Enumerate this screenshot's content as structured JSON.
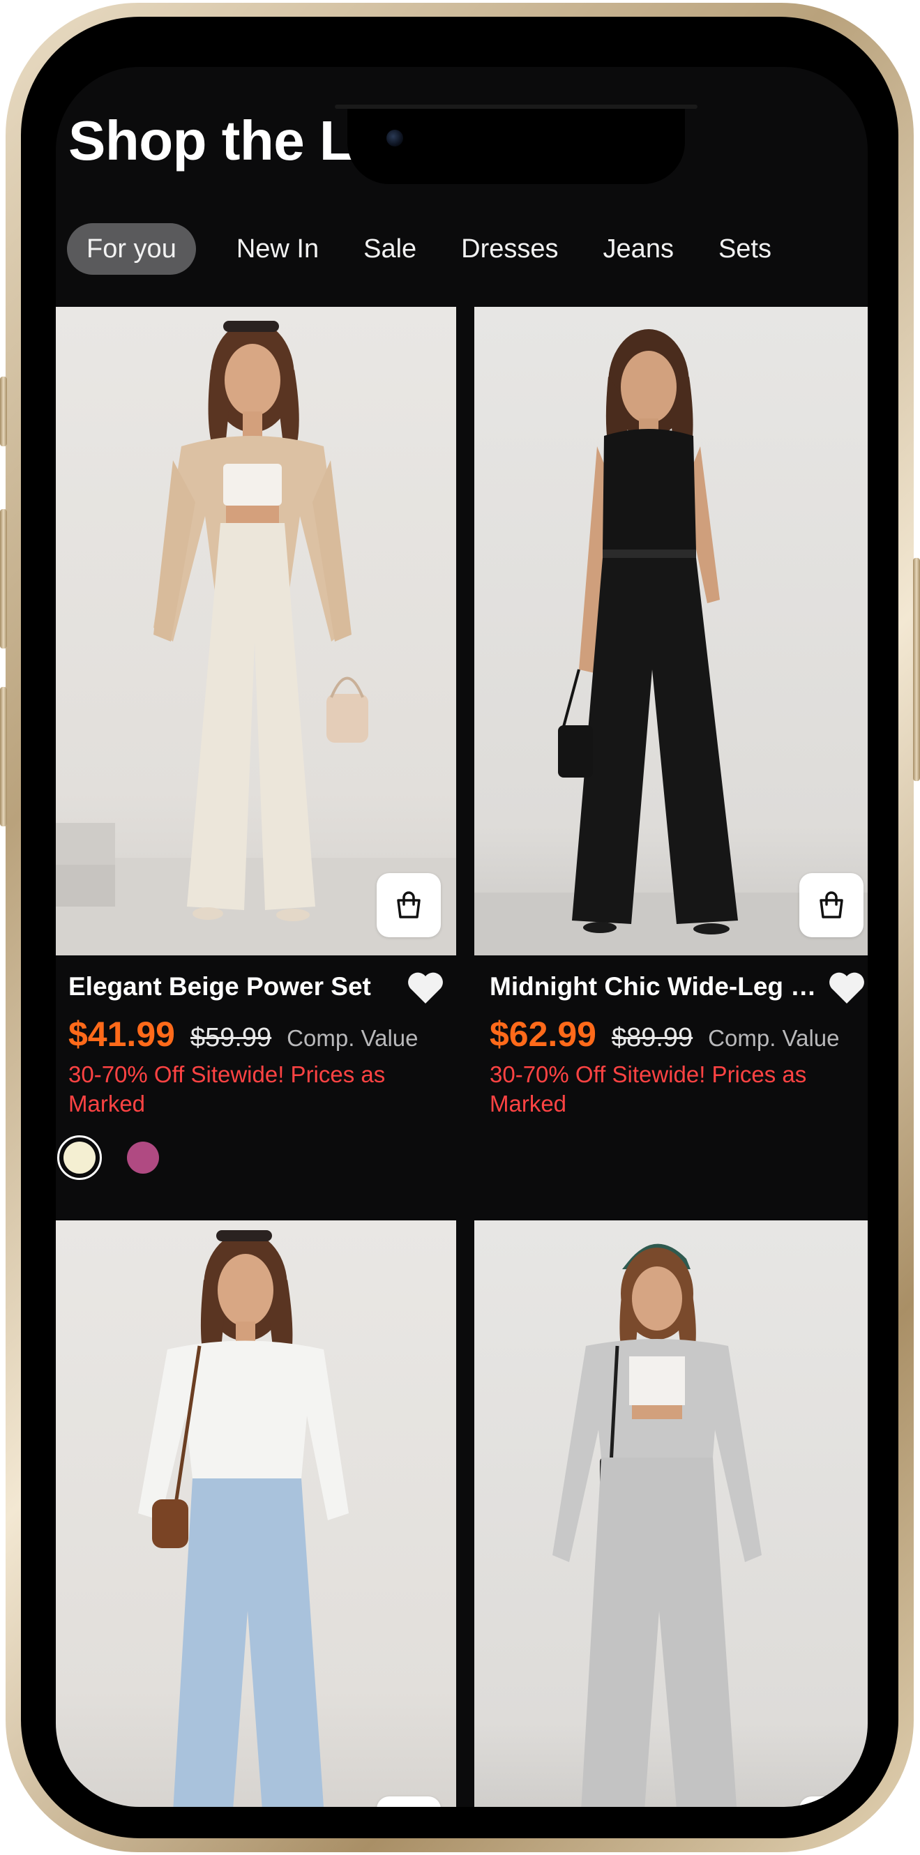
{
  "header": {
    "title": "Shop the Latest"
  },
  "tabs": [
    {
      "label": "For you",
      "active": true
    },
    {
      "label": "New In",
      "active": false
    },
    {
      "label": "Sale",
      "active": false
    },
    {
      "label": "Dresses",
      "active": false
    },
    {
      "label": "Jeans",
      "active": false
    },
    {
      "label": "Sets",
      "active": false
    }
  ],
  "products": [
    {
      "name": "Elegant Beige Power Set",
      "price": "$41.99",
      "old_price": "$59.99",
      "comp_label": "Comp. Value",
      "promo": "30-70% Off Sitewide! Prices as Marked",
      "swatches": [
        "#f4efd2",
        "#b04a82"
      ]
    },
    {
      "name": "Midnight Chic Wide-Leg J...",
      "price": "$62.99",
      "old_price": "$89.99",
      "comp_label": "Comp. Value",
      "promo": "30-70% Off Sitewide! Prices as Marked",
      "swatches": []
    }
  ],
  "colors": {
    "background": "#0b0b0c",
    "price": "#ff6a1a",
    "promo": "#ff4343",
    "active_tab": "#5a5a5c"
  },
  "icons": {
    "bag": "shopping-bag-icon",
    "favorite": "heart-icon"
  }
}
